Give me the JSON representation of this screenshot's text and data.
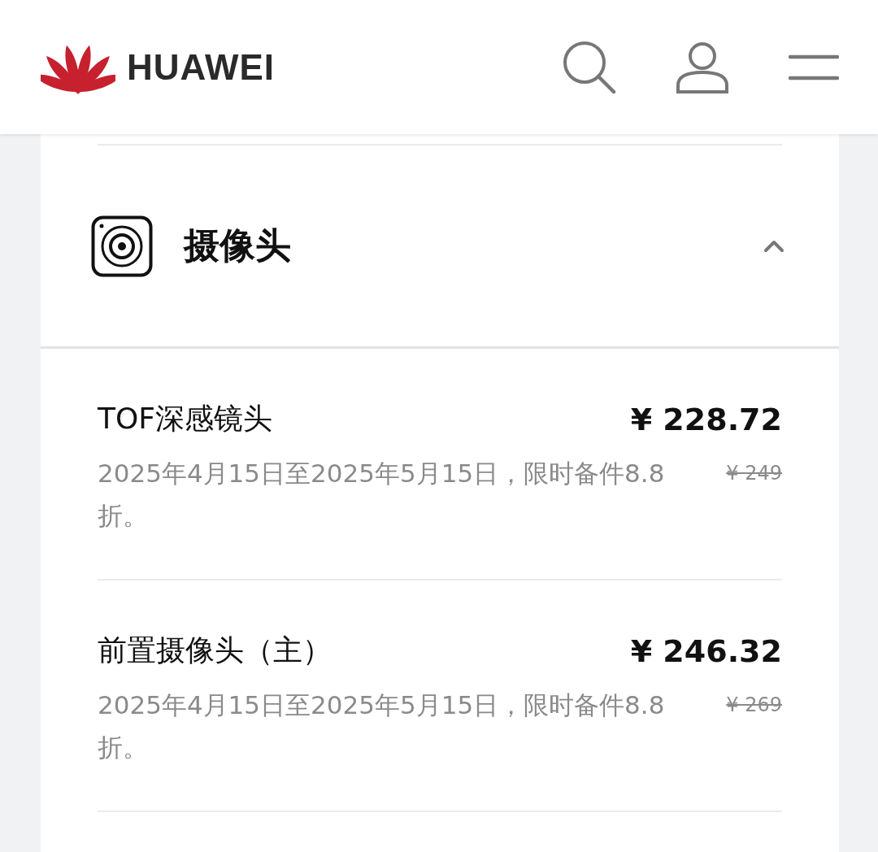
{
  "header": {
    "brand": "HUAWEI"
  },
  "section": {
    "title": "摄像头",
    "expanded": true,
    "items": [
      {
        "name": "TOF深感镜头",
        "price": "¥ 228.72",
        "description": "2025年4月15日至2025年5月15日，限时备件8.8折。",
        "original_price": "¥ 249"
      },
      {
        "name": "前置摄像头（主）",
        "price": "¥ 246.32",
        "description": "2025年4月15日至2025年5月15日，限时备件8.8折。",
        "original_price": "¥ 269"
      }
    ]
  }
}
